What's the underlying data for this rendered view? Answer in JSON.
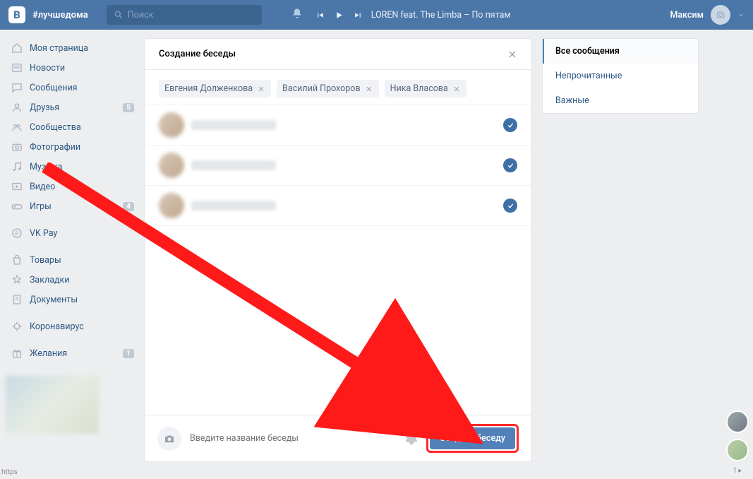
{
  "header": {
    "logo": "B",
    "hashtag": "#лучшедома",
    "search_placeholder": "Поиск",
    "track": "LOREN feat. The Limba – По пятам",
    "username": "Максим"
  },
  "nav": {
    "items": [
      {
        "label": "Моя страница",
        "icon": "home"
      },
      {
        "label": "Новости",
        "icon": "news"
      },
      {
        "label": "Сообщения",
        "icon": "msg"
      },
      {
        "label": "Друзья",
        "icon": "friends",
        "badge": "5"
      },
      {
        "label": "Сообщества",
        "icon": "groups"
      },
      {
        "label": "Фотографии",
        "icon": "photo"
      },
      {
        "label": "Музыка",
        "icon": "music"
      },
      {
        "label": "Видео",
        "icon": "video"
      },
      {
        "label": "Игры",
        "icon": "games",
        "badge": "4"
      }
    ],
    "items2": [
      {
        "label": "VK Pay",
        "icon": "pay"
      }
    ],
    "items3": [
      {
        "label": "Товары",
        "icon": "market"
      },
      {
        "label": "Закладки",
        "icon": "bookmark"
      },
      {
        "label": "Документы",
        "icon": "docs"
      }
    ],
    "items4": [
      {
        "label": "Коронавирус",
        "icon": "virus"
      }
    ],
    "items5": [
      {
        "label": "Желания",
        "icon": "wish",
        "badge": "1"
      }
    ]
  },
  "modal": {
    "title": "Создание беседы",
    "chips": [
      "Евгения Долженкова",
      "Василий Прохоров",
      "Ника Власова"
    ],
    "people_count": 3,
    "name_placeholder": "Введите название беседы",
    "create_label": "Создать беседу"
  },
  "filters": {
    "items": [
      "Все сообщения",
      "Непрочитанные",
      "Важные"
    ],
    "active_index": 0
  },
  "status_text": "https",
  "float_count": "1"
}
